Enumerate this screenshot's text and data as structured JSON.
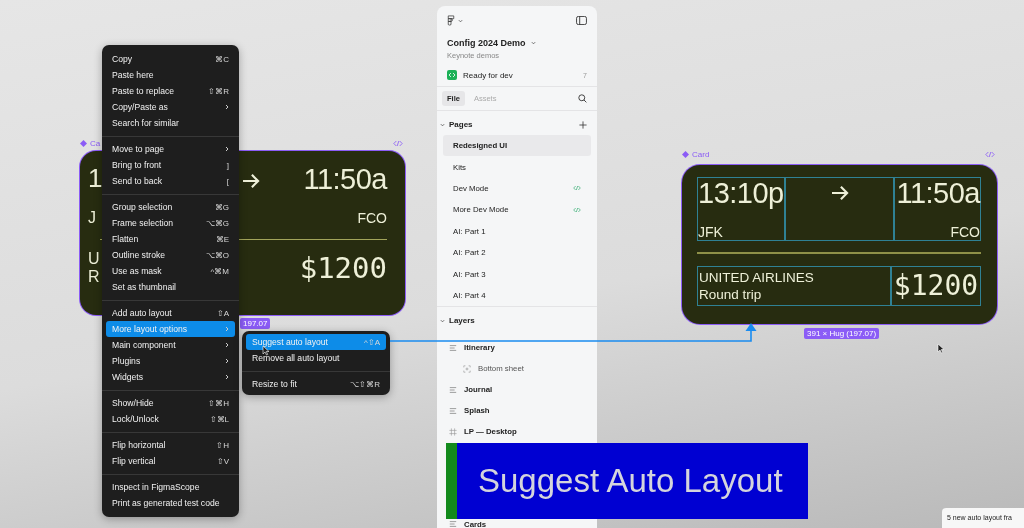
{
  "left_card": {
    "label": "Ca",
    "fragments": [
      "1",
      "J",
      "U",
      "R"
    ],
    "arrive_time": "11:50a",
    "arrive_code": "FCO",
    "price": "$1200",
    "size_tag": "197.07"
  },
  "context_menu": {
    "groups": [
      {
        "items": [
          {
            "label": "Copy",
            "shortcut": "⌘C",
            "submenu": false,
            "selected": false
          },
          {
            "label": "Paste here",
            "submenu": false,
            "selected": false
          },
          {
            "label": "Paste to replace",
            "shortcut": "⇧⌘R",
            "submenu": false,
            "selected": false
          },
          {
            "label": "Copy/Paste as",
            "submenu": true,
            "selected": false
          },
          {
            "label": "Search for similar",
            "submenu": false,
            "selected": false
          }
        ]
      },
      {
        "items": [
          {
            "label": "Move to page",
            "submenu": true,
            "selected": false
          },
          {
            "label": "Bring to front",
            "shortcut": "]",
            "submenu": false,
            "selected": false
          },
          {
            "label": "Send to back",
            "shortcut": "[",
            "submenu": false,
            "selected": false
          }
        ]
      },
      {
        "items": [
          {
            "label": "Group selection",
            "shortcut": "⌘G",
            "submenu": false,
            "selected": false
          },
          {
            "label": "Frame selection",
            "shortcut": "⌥⌘G",
            "submenu": false,
            "selected": false
          },
          {
            "label": "Flatten",
            "shortcut": "⌘E",
            "submenu": false,
            "selected": false
          },
          {
            "label": "Outline stroke",
            "shortcut": "⌥⌘O",
            "submenu": false,
            "selected": false
          },
          {
            "label": "Use as mask",
            "shortcut": "^⌘M",
            "submenu": false,
            "selected": false
          },
          {
            "label": "Set as thumbnail",
            "submenu": false,
            "selected": false
          }
        ]
      },
      {
        "items": [
          {
            "label": "Add auto layout",
            "shortcut": "⇧A",
            "submenu": false,
            "selected": false
          },
          {
            "label": "More layout options",
            "submenu": true,
            "selected": true
          },
          {
            "label": "Main component",
            "submenu": true,
            "selected": false
          },
          {
            "label": "Plugins",
            "submenu": true,
            "selected": false
          },
          {
            "label": "Widgets",
            "submenu": true,
            "selected": false
          }
        ]
      },
      {
        "items": [
          {
            "label": "Show/Hide",
            "shortcut": "⇧⌘H",
            "submenu": false,
            "selected": false
          },
          {
            "label": "Lock/Unlock",
            "shortcut": "⇧⌘L",
            "submenu": false,
            "selected": false
          }
        ]
      },
      {
        "items": [
          {
            "label": "Flip horizontal",
            "shortcut": "⇧H",
            "submenu": false,
            "selected": false
          },
          {
            "label": "Flip vertical",
            "shortcut": "⇧V",
            "submenu": false,
            "selected": false
          }
        ]
      },
      {
        "items": [
          {
            "label": "Inspect in FigmaScope",
            "submenu": false,
            "selected": false
          },
          {
            "label": "Print as generated test code",
            "submenu": false,
            "selected": false
          }
        ]
      }
    ]
  },
  "submenu": {
    "groups": [
      {
        "items": [
          {
            "label": "Suggest auto layout",
            "shortcut": "^⇧A",
            "selected": true
          },
          {
            "label": "Remove all auto layout",
            "selected": false
          }
        ]
      },
      {
        "items": [
          {
            "label": "Resize to fit",
            "shortcut": "⌥⇧⌘R",
            "selected": false
          }
        ]
      }
    ]
  },
  "sidebar": {
    "file_title": "Config 2024 Demo",
    "team": "Keynote demos",
    "status": "Ready for dev",
    "status_count": "7",
    "tabs": [
      {
        "label": "File",
        "selected": true
      },
      {
        "label": "Assets",
        "selected": false
      }
    ],
    "pages_heading": "Pages",
    "pages": [
      {
        "label": "Redesigned UI",
        "selected": true,
        "dev": false
      },
      {
        "label": "Kits",
        "selected": false,
        "dev": false
      },
      {
        "label": "Dev Mode",
        "selected": false,
        "dev": true
      },
      {
        "label": "More Dev Mode",
        "selected": false,
        "dev": true
      },
      {
        "label": "AI: Part 1",
        "selected": false,
        "dev": false
      },
      {
        "label": "AI: Part 2",
        "selected": false,
        "dev": false
      },
      {
        "label": "AI: Part 3",
        "selected": false,
        "dev": false
      },
      {
        "label": "AI: Part 4",
        "selected": false,
        "dev": false
      }
    ],
    "layers_heading": "Layers",
    "layers": [
      {
        "label": "Itinerary",
        "kind": "autolayout",
        "children": [
          {
            "label": "Bottom sheet",
            "kind": "frame"
          }
        ]
      },
      {
        "label": "Journal",
        "kind": "autolayout"
      },
      {
        "label": "Splash",
        "kind": "autolayout"
      },
      {
        "label": "LP — Desktop",
        "kind": "grid"
      },
      {
        "label": "Cards",
        "kind": "autolayout"
      }
    ]
  },
  "right_card": {
    "label": "Card",
    "depart_time": "13:10p",
    "depart_code": "JFK",
    "arrive_time": "11:50a",
    "arrive_code": "FCO",
    "airline": "UNITED AIRLINES",
    "trip": "Round trip",
    "price": "$1200",
    "size_tag": "391 × Hug (197.07)"
  },
  "caption": "Suggest Auto Layout",
  "toast": "5 new auto layout fra"
}
